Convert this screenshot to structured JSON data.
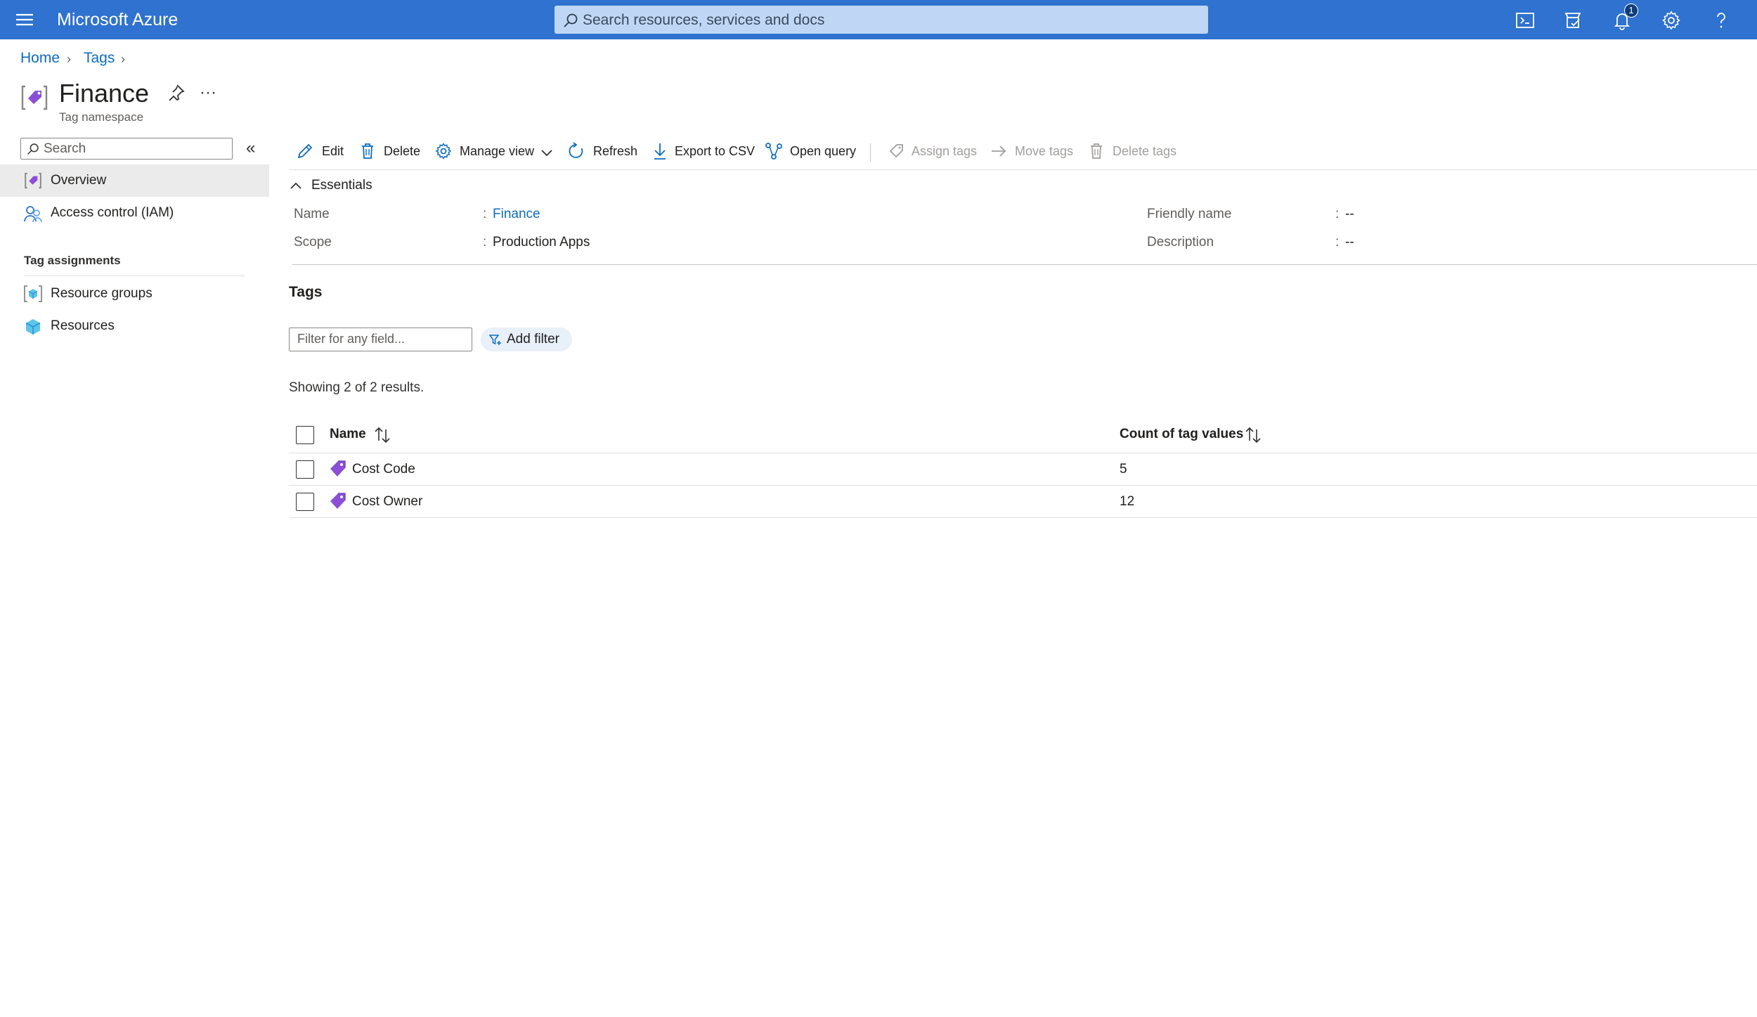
{
  "app": {
    "title": "Microsoft Azure",
    "search_placeholder": "Search resources, services and docs",
    "notification_count": "1"
  },
  "breadcrumb": {
    "home": "Home",
    "tags": "Tags"
  },
  "page": {
    "title": "Finance",
    "subtitle": "Tag namespace"
  },
  "nav": {
    "search_placeholder": "Search",
    "overview": "Overview",
    "iam": "Access control (IAM)",
    "group_label": "Tag assignments",
    "resource_groups": "Resource groups",
    "resources": "Resources"
  },
  "toolbar": {
    "edit": "Edit",
    "delete": "Delete",
    "manage_view": "Manage view",
    "refresh": "Refresh",
    "export": "Export to CSV",
    "open_query": "Open query",
    "assign_tags": "Assign tags",
    "move_tags": "Move tags",
    "delete_tags": "Delete tags"
  },
  "essentials": {
    "title": "Essentials",
    "name_label": "Name",
    "name_value": "Finance",
    "scope_label": "Scope",
    "scope_value": "Production Apps",
    "friendly_label": "Friendly name",
    "friendly_value": "--",
    "desc_label": "Description",
    "desc_value": "--",
    "colon": ":"
  },
  "tags": {
    "heading": "Tags",
    "filter_placeholder": "Filter for any field...",
    "add_filter": "Add filter",
    "results": "Showing 2 of 2 results.",
    "columns": {
      "name": "Name",
      "count": "Count of tag values"
    },
    "rows": [
      {
        "name": "Cost Code",
        "count": "5"
      },
      {
        "name": "Cost Owner",
        "count": "12"
      }
    ]
  },
  "colors": {
    "topbar": "#2f72cf",
    "link": "#0f6cbd",
    "tag_icon": "#8a4fd6"
  }
}
